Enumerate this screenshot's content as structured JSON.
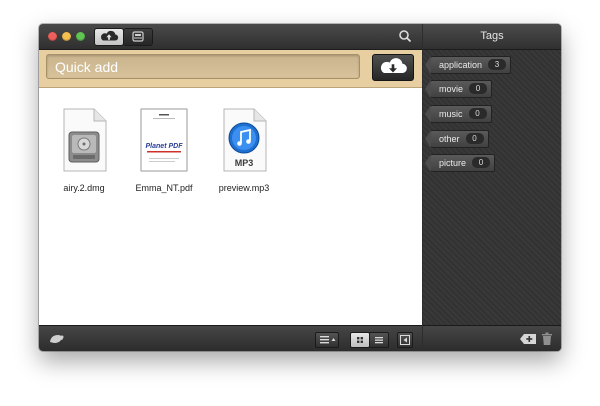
{
  "colors": {
    "accent_bar": "#e7cfa1",
    "tag_pane": "#343434",
    "close": "#ee5f5b",
    "minimize": "#f5bf4f",
    "zoom": "#61c554"
  },
  "toolbar": {
    "upload_icon": "cloud-upload-icon",
    "drive_icon": "drive-icon",
    "search_icon": "search-icon"
  },
  "quick_add": {
    "placeholder": "Quick add",
    "button_icon": "cloud-download-icon"
  },
  "files": [
    {
      "name": "airy.2.dmg",
      "icon": "disk-image-icon"
    },
    {
      "name": "Emma_NT.pdf",
      "icon": "pdf-document-icon",
      "thumb_text": "Planet PDF"
    },
    {
      "name": "preview.mp3",
      "icon": "music-file-icon",
      "thumb_text": "MP3"
    }
  ],
  "bottom": {
    "left_icon": "turtle-icon",
    "sort_icon": "sort-menu-icon",
    "grid_view_icon": "grid-view-icon",
    "list_view_icon": "list-view-icon",
    "toggle_icon": "toggle-panel-icon"
  },
  "tags": {
    "title": "Tags",
    "items": [
      {
        "label": "application",
        "count": "3"
      },
      {
        "label": "movie",
        "count": "0"
      },
      {
        "label": "music",
        "count": "0"
      },
      {
        "label": "other",
        "count": "0"
      },
      {
        "label": "picture",
        "count": "0"
      }
    ],
    "add_icon": "add-tag-icon",
    "delete_icon": "trash-icon"
  }
}
